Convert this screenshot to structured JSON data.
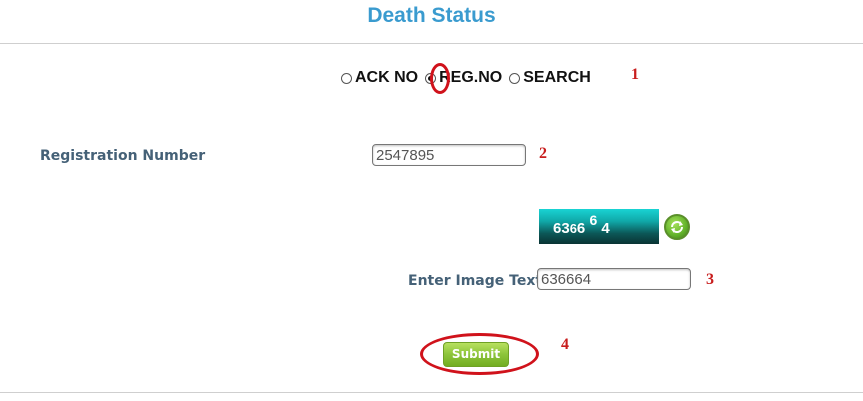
{
  "page": {
    "title": "Death Status"
  },
  "search_type": {
    "options": [
      {
        "label": "ACK NO",
        "selected": false
      },
      {
        "label": "REG.NO",
        "selected": true
      },
      {
        "label": "SEARCH",
        "selected": false
      }
    ]
  },
  "registration": {
    "label": "Registration Number",
    "value": "2547895"
  },
  "captcha": {
    "image_text": [
      "6",
      "3",
      "6",
      "6",
      "6",
      "4"
    ],
    "refresh_icon": "refresh-icon"
  },
  "image_text_field": {
    "label": "Enter Image Text",
    "value": "636664"
  },
  "submit": {
    "label": "Submit"
  },
  "annotations": {
    "step1": "1",
    "step2": "2",
    "step3": "3",
    "step4": "4",
    "color": "#d0121b"
  }
}
